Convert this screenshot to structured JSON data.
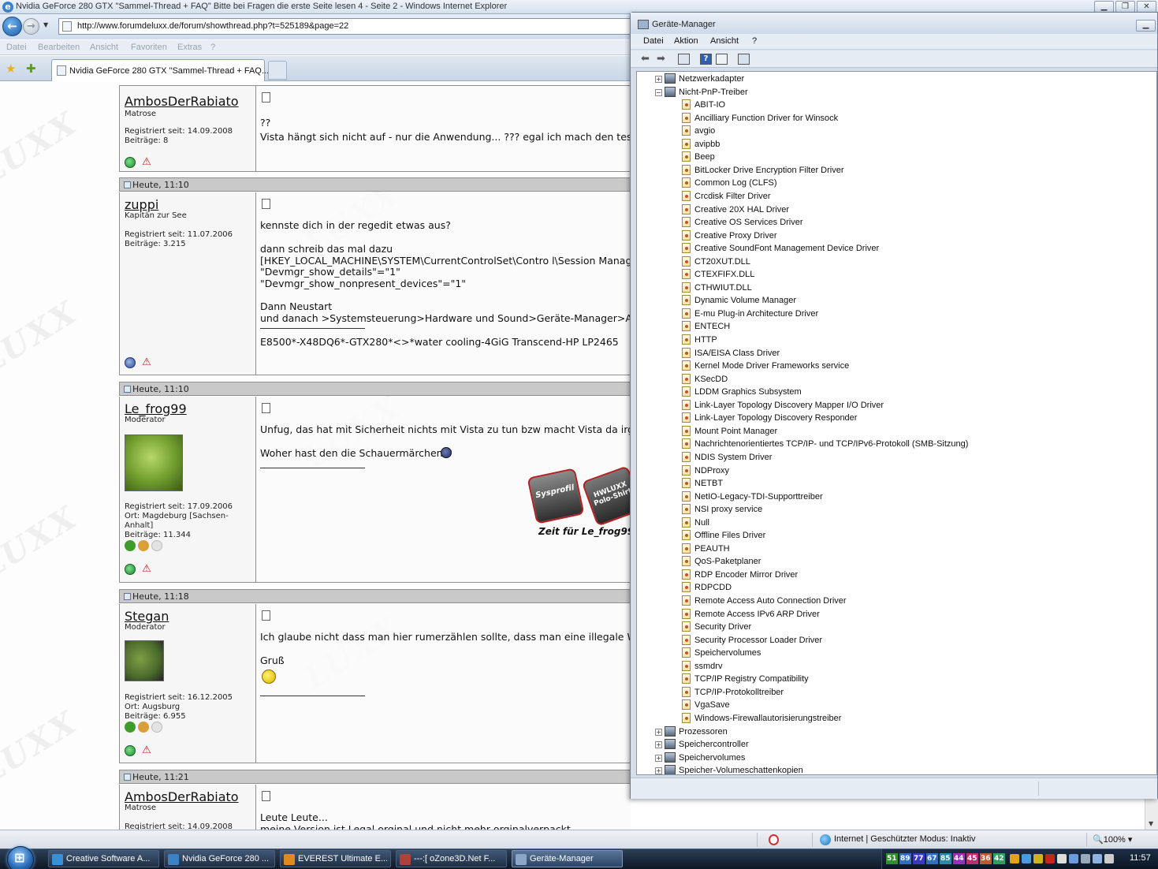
{
  "ie": {
    "window_title": "Nvidia GeForce 280 GTX \"Sammel-Thread + FAQ\" Bitte bei Fragen die erste Seite lesen 4 - Seite 2 - Windows Internet Explorer",
    "address": "http://www.forumdeluxx.de/forum/showthread.php?t=525189&page=22",
    "menu": [
      "Datei",
      "Bearbeiten",
      "Ansicht",
      "Favoriten",
      "Extras",
      "?"
    ],
    "tab_title": "Nvidia GeForce 280 GTX \"Sammel-Thread + FAQ...",
    "status": {
      "zone": "Internet | Geschützter Modus: Inaktiv",
      "zoom": "100%"
    }
  },
  "posts": [
    {
      "header": "",
      "username": "AmbosDerRabiato",
      "rank": "Matrose",
      "info": "Registriert seit: 14.09.2008\nBeiträge: 8",
      "lines": [
        "??",
        "Vista hängt sich nicht auf - nur die Anwendung... ??? egal ich mach den test"
      ]
    },
    {
      "header": "Heute, 11:10",
      "username": "zuppi",
      "rank": "Kapitän zur See",
      "info": "Registriert seit: 11.07.2006\nBeiträge: 3.215",
      "lines": [
        "kennste dich in der regedit etwas aus?",
        "",
        "dann schreib das mal dazu",
        "[HKEY_LOCAL_MACHINE\\SYSTEM\\CurrentControlSet\\Contro l\\Session Manager",
        "\"Devmgr_show_details\"=\"1\"",
        "\"Devmgr_show_nonpresent_devices\"=\"1\"",
        "",
        "Dann Neustart",
        "und danach >Systemsteuerung>Hardware und Sound>Geräte-Manager>Ansicht"
      ],
      "signature": "E8500*-X48DQ6*-GTX280*<>*water cooling-4GiG Transcend-HP LP2465"
    },
    {
      "header": "Heute, 11:10",
      "username": "Le_frog99",
      "rank": "Moderator",
      "info": "Registriert seit: 17.09.2006\nOrt: Magdeburg [Sachsen-\nAnhalt]\nBeiträge: 11.344",
      "lines": [
        "Unfug, das hat mit Sicherheit nichts mit Vista zu tun bzw macht Vista da irge",
        "",
        "Woher hast den die Schauermärchen"
      ],
      "sig_button_1": "Sysprofil",
      "sig_button_2": "HWLUXX Polo-Shirt",
      "sig_caption": "Zeit für Le_frog99."
    },
    {
      "header": "Heute, 11:18",
      "username": "Stegan",
      "rank": "Moderator",
      "info": "Registriert seit: 16.12.2005\nOrt: Augsburg\nBeiträge: 6.955",
      "lines": [
        "Ich glaube nicht dass man hier rumerzählen sollte, dass man eine illegale Win",
        "",
        "Gruß"
      ]
    },
    {
      "header": "Heute, 11:21",
      "username": "AmbosDerRabiato",
      "rank": "Matrose",
      "info": "Registriert seit: 14.09.2008",
      "lines": [
        "Leute Leute...",
        "meine Version ist Legal orginal und nicht mehr orginalverpackt"
      ]
    }
  ],
  "devmgr": {
    "title": "Geräte-Manager",
    "menu": [
      "Datei",
      "Aktion",
      "Ansicht",
      "?"
    ],
    "top_categories": [
      {
        "label": "Netzwerkadapter",
        "expanded": false
      }
    ],
    "open_category": {
      "label": "Nicht-PnP-Treiber",
      "expanded": true
    },
    "drivers": [
      "ABIT-IO",
      "Ancilliary Function Driver for Winsock",
      "avgio",
      "avipbb",
      "Beep",
      "BitLocker Drive Encryption Filter Driver",
      "Common Log (CLFS)",
      "Crcdisk Filter Driver",
      "Creative 20X HAL Driver",
      "Creative OS Services Driver",
      "Creative Proxy Driver",
      "Creative SoundFont Management Device Driver",
      "CT20XUT.DLL",
      "CTEXFIFX.DLL",
      "CTHWIUT.DLL",
      "Dynamic Volume Manager",
      "E-mu Plug-in Architecture Driver",
      "ENTECH",
      "HTTP",
      "ISA/EISA Class Driver",
      "Kernel Mode Driver Frameworks service",
      "KSecDD",
      "LDDM Graphics Subsystem",
      "Link-Layer Topology Discovery Mapper I/O Driver",
      "Link-Layer Topology Discovery Responder",
      "Mount Point Manager",
      "Nachrichtenorientiertes TCP/IP- und TCP/IPv6-Protokoll (SMB-Sitzung)",
      "NDIS System Driver",
      "NDProxy",
      "NETBT",
      "NetIO-Legacy-TDI-Supporttreiber",
      "NSI proxy service",
      "Null",
      "Offline Files Driver",
      "PEAUTH",
      "QoS-Paketplaner",
      "RDP Encoder Mirror Driver",
      "RDPCDD",
      "Remote Access Auto Connection Driver",
      "Remote Access IPv6 ARP Driver",
      "Security Driver",
      "Security Processor Loader Driver",
      "Speichervolumes",
      "ssmdrv",
      "TCP/IP Registry Compatibility",
      "TCP/IP-Protokolltreiber",
      "VgaSave",
      "Windows-Firewallautorisierungstreiber"
    ],
    "bottom_categories": [
      {
        "label": "Prozessoren"
      },
      {
        "label": "Speichercontroller"
      },
      {
        "label": "Speichervolumes"
      },
      {
        "label": "Speicher-Volumeschattenkopien"
      }
    ]
  },
  "taskbar": {
    "tasks": [
      {
        "label": "Creative Software A...",
        "icon_color": "#3b8fd6"
      },
      {
        "label": "Nvidia GeForce 280 ...",
        "icon_color": "#3d82c4"
      },
      {
        "label": "EVEREST Ultimate E...",
        "icon_color": "#e08a1e"
      },
      {
        "label": "---:[ oZone3D.Net F...",
        "icon_color": "#b0403a"
      },
      {
        "label": "Geräte-Manager",
        "icon_color": "#8ca6c8"
      }
    ],
    "tray_numbers": [
      {
        "value": "51",
        "color": "#2f8f2f"
      },
      {
        "value": "89",
        "color": "#2f6fbf"
      },
      {
        "value": "77",
        "color": "#3a3ac0"
      },
      {
        "value": "67",
        "color": "#2f6fbf"
      },
      {
        "value": "85",
        "color": "#2a8aa8"
      },
      {
        "value": "44",
        "color": "#9a2fbf"
      },
      {
        "value": "45",
        "color": "#bf2f6f"
      },
      {
        "value": "36",
        "color": "#bf5a2f"
      },
      {
        "value": "42",
        "color": "#2f9f5f"
      }
    ],
    "clock": "11:57"
  }
}
